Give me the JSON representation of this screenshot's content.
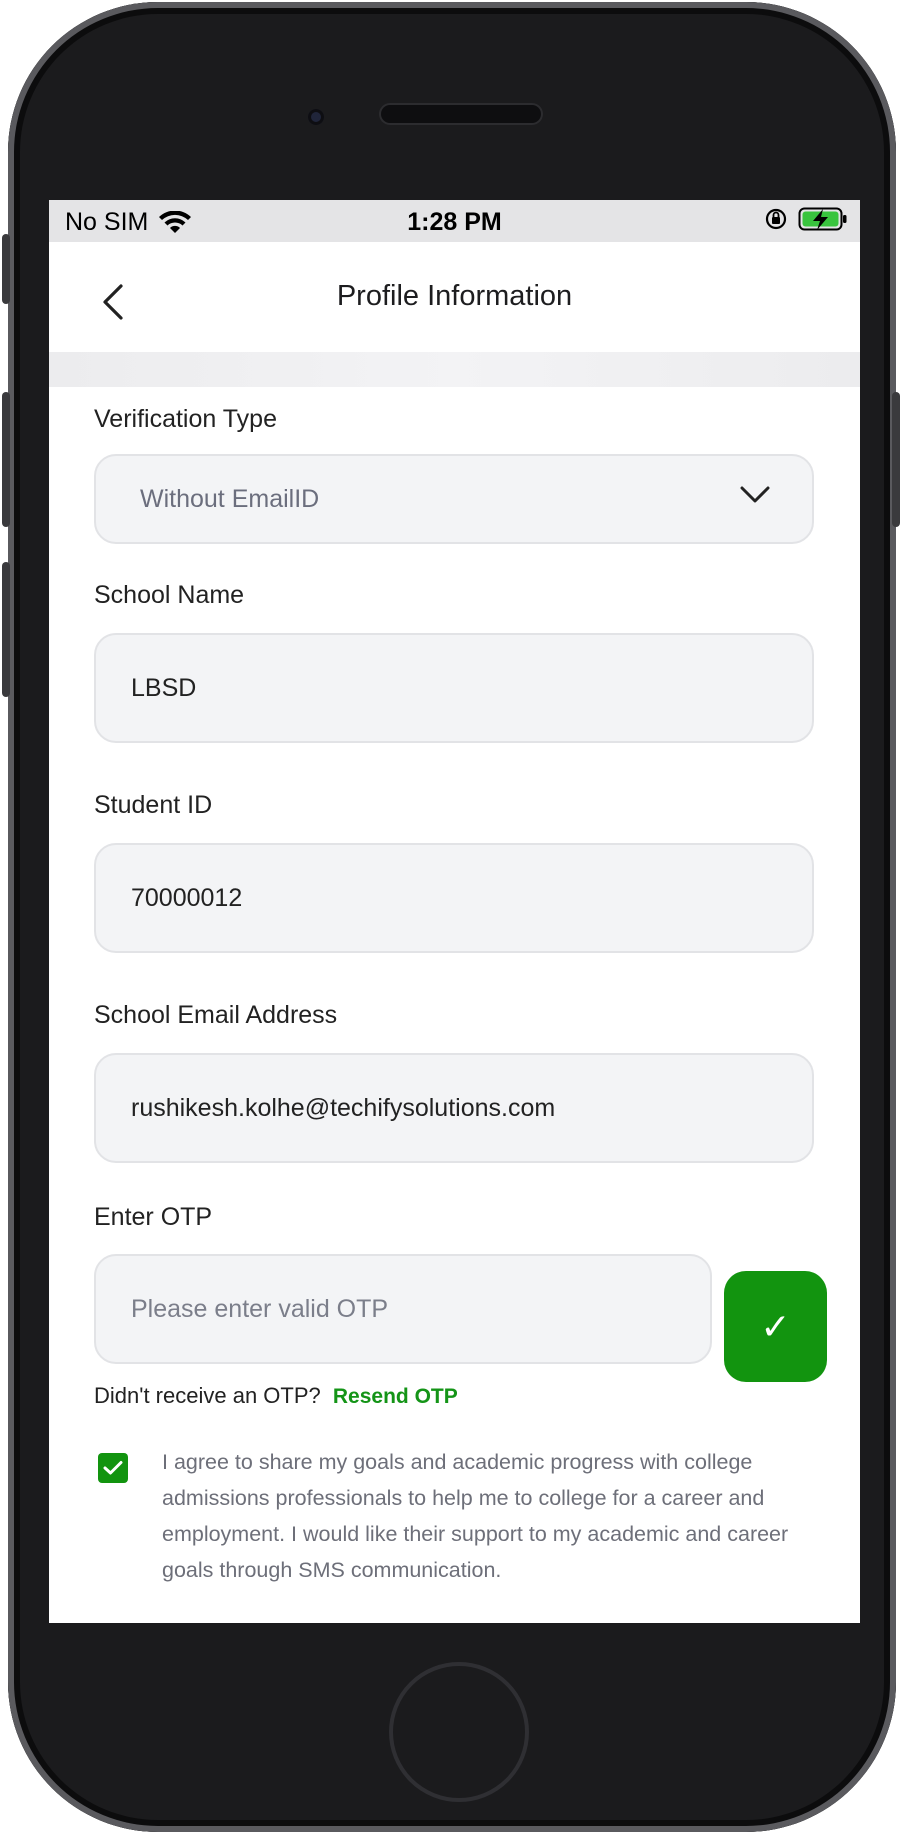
{
  "status_bar": {
    "carrier": "No SIM",
    "time": "1:28 PM",
    "wifi_icon": "wifi-icon",
    "orientation_lock_icon": "orientation-lock-icon",
    "battery_icon": "battery-charging-icon"
  },
  "nav": {
    "title": "Profile Information",
    "back_icon": "chevron-left-icon"
  },
  "form": {
    "verification_type": {
      "label": "Verification Type",
      "value": "Without EmailID"
    },
    "school_name": {
      "label": "School Name",
      "value": "LBSD"
    },
    "student_id": {
      "label": "Student ID",
      "value": "70000012"
    },
    "school_email": {
      "label": "School Email Address",
      "value": "rushikesh.kolhe@techifysolutions.com"
    },
    "otp": {
      "label": "Enter OTP",
      "placeholder": "Please enter valid OTP",
      "verify_button": "✓"
    },
    "resend": {
      "prompt": "Didn't receive an OTP?",
      "link": "Resend OTP"
    },
    "consent": {
      "checked": true,
      "text": "I agree to share my goals and academic progress with college admissions professionals to help me to college for a career and employment. I would like their support to my academic and career goals through SMS communication."
    }
  },
  "colors": {
    "accent": "#12940f",
    "field_bg": "#f3f4f6",
    "status_bar_bg": "#e4e4e6"
  }
}
